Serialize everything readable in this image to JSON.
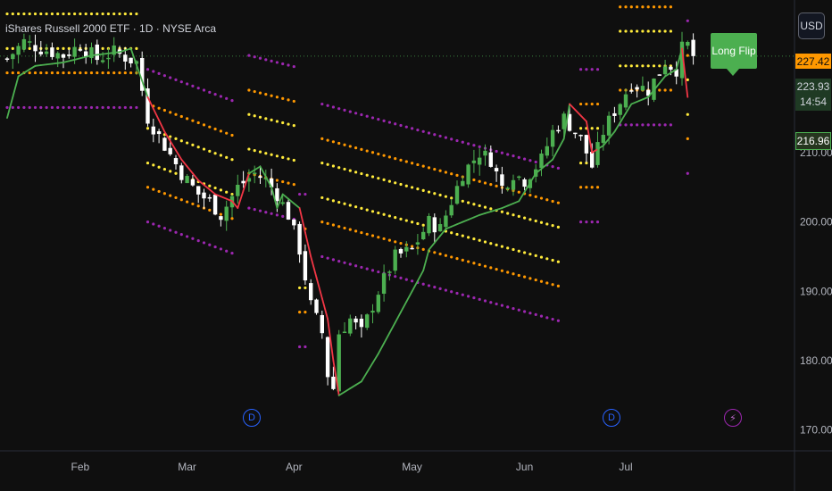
{
  "header": {
    "title": "iShares Russell 2000 ETF · 1D · NYSE Arca"
  },
  "currency_button": {
    "label": "USD"
  },
  "price_axis": {
    "current_price_tag": "227.42",
    "last_price": "223.93",
    "countdown": "14:54",
    "indicator_value": "216.96"
  },
  "signal_label": {
    "text": "Long Flip"
  },
  "events": [
    {
      "icon": "dividend-icon",
      "label": "D",
      "date": "2025-03-24"
    },
    {
      "icon": "dividend-icon",
      "label": "D",
      "date": "2025-06-09"
    },
    {
      "icon": "lightning-icon",
      "label": "⚡",
      "date": "2025-07-17"
    }
  ],
  "colors": {
    "background": "#0f0f0f",
    "bull_candle": "#4caf50",
    "bear_candle": "#ffffff",
    "trail_up": "#4caf50",
    "trail_down": "#f23645",
    "band_inner": "#ffeb3b",
    "band_mid": "#ff9800",
    "band_outer": "#9c27b0"
  },
  "chart_data": {
    "type": "candlestick",
    "xlabels": [
      "Feb",
      "Mar",
      "Apr",
      "May",
      "Jun",
      "Jul"
    ],
    "ylabels": [
      "170.00",
      "180.00",
      "190.00",
      "200.00",
      "210.00"
    ],
    "ylim": [
      167,
      232
    ],
    "n_bars": 130,
    "month_ticks": [
      {
        "label": "Feb",
        "bar": 13
      },
      {
        "label": "Mar",
        "bar": 32
      },
      {
        "label": "Apr",
        "bar": 51
      },
      {
        "label": "May",
        "bar": 72
      },
      {
        "label": "Jun",
        "bar": 92
      },
      {
        "label": "Jul",
        "bar": 110
      }
    ],
    "close_anchors": [
      [
        0,
        223.5
      ],
      [
        3,
        226
      ],
      [
        6,
        225
      ],
      [
        10,
        224
      ],
      [
        13,
        225.5
      ],
      [
        16,
        223.5
      ],
      [
        19,
        224.5
      ],
      [
        23,
        223
      ],
      [
        25,
        215
      ],
      [
        28,
        211
      ],
      [
        31,
        207
      ],
      [
        34,
        204
      ],
      [
        36,
        203
      ],
      [
        38,
        201
      ],
      [
        41,
        205
      ],
      [
        44,
        207
      ],
      [
        46,
        206
      ],
      [
        48,
        204
      ],
      [
        50,
        201
      ],
      [
        52,
        196
      ],
      [
        54,
        188
      ],
      [
        56,
        184
      ],
      [
        57,
        178
      ],
      [
        58,
        176
      ],
      [
        59,
        184
      ],
      [
        61,
        186
      ],
      [
        63,
        184
      ],
      [
        66,
        190
      ],
      [
        69,
        195
      ],
      [
        72,
        196
      ],
      [
        75,
        200
      ],
      [
        77,
        199
      ],
      [
        79,
        203
      ],
      [
        81,
        207
      ],
      [
        84,
        210
      ],
      [
        86,
        209
      ],
      [
        88,
        205
      ],
      [
        90,
        207
      ],
      [
        92,
        206
      ],
      [
        95,
        209
      ],
      [
        97,
        213
      ],
      [
        99,
        215
      ],
      [
        101,
        213
      ],
      [
        102,
        212
      ],
      [
        104,
        208
      ],
      [
        106,
        213
      ],
      [
        108,
        216
      ],
      [
        111,
        220
      ],
      [
        114,
        219
      ],
      [
        117,
        223
      ],
      [
        119,
        222
      ],
      [
        120,
        225
      ],
      [
        121,
        225.5
      ],
      [
        122,
        223.9
      ]
    ],
    "trail_anchors": [
      [
        0,
        215
      ],
      [
        2,
        221
      ],
      [
        5,
        222.5
      ],
      [
        10,
        223
      ],
      [
        15,
        224
      ],
      [
        20,
        224.5
      ],
      [
        22,
        225
      ],
      [
        25,
        218
      ],
      [
        28,
        213
      ],
      [
        31,
        209
      ],
      [
        34,
        206
      ],
      [
        37,
        204
      ],
      [
        40,
        203
      ],
      [
        41,
        202
      ],
      [
        43,
        207
      ],
      [
        45,
        208
      ],
      [
        47,
        205
      ],
      [
        48,
        202
      ],
      [
        49,
        204
      ],
      [
        52,
        202
      ],
      [
        54,
        195
      ],
      [
        56,
        189
      ],
      [
        57,
        186
      ],
      [
        58,
        180
      ],
      [
        59,
        175
      ],
      [
        63,
        177
      ],
      [
        66,
        181
      ],
      [
        70,
        187
      ],
      [
        74,
        193
      ],
      [
        75,
        196
      ],
      [
        78,
        199
      ],
      [
        81,
        200
      ],
      [
        84,
        201
      ],
      [
        88,
        202
      ],
      [
        91,
        203
      ],
      [
        94,
        207
      ],
      [
        97,
        209
      ],
      [
        99,
        212
      ],
      [
        100,
        217
      ],
      [
        103,
        214.5
      ],
      [
        104,
        210
      ],
      [
        106,
        211
      ],
      [
        108,
        213
      ],
      [
        111,
        217
      ],
      [
        114,
        218
      ],
      [
        117,
        221
      ],
      [
        119,
        222
      ],
      [
        120,
        225
      ],
      [
        121,
        218
      ]
    ],
    "trail_bear_ranges": [
      [
        25,
        42
      ],
      [
        52,
        58
      ],
      [
        100,
        104
      ],
      [
        120,
        121
      ]
    ],
    "band_segments": [
      {
        "start": 0,
        "end": 23,
        "base": 227.5,
        "slope": 0
      },
      {
        "start": 25,
        "end": 40,
        "base": 211,
        "slope": -0.3
      },
      {
        "start": 43,
        "end": 51,
        "base": 213,
        "slope": -0.2
      },
      {
        "start": 52,
        "end": 53,
        "base": 193,
        "slope": 0
      },
      {
        "start": 56,
        "end": 98,
        "base": 206,
        "slope": -0.22
      },
      {
        "start": 102,
        "end": 105,
        "base": 211,
        "slope": 0
      },
      {
        "start": 109,
        "end": 118,
        "base": 225,
        "slope": 0
      },
      {
        "start": 121,
        "end": 121,
        "base": 218,
        "slope": 0
      }
    ],
    "band_offsets": {
      "inner": 2.5,
      "mid": 6,
      "outer": 11
    }
  }
}
